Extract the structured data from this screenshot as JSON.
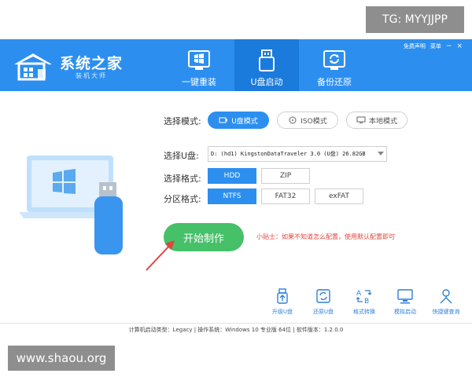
{
  "watermarks": {
    "tg": "TG: MYYJJPP",
    "site": "www.shaou.org"
  },
  "header": {
    "logo_title": "系统之家",
    "logo_subtitle": "装机大师",
    "top_links": [
      "免费声明",
      "菜单"
    ],
    "window_controls": [
      "−",
      "×"
    ],
    "brand_color": "#2c8ff0",
    "tabs": [
      {
        "label": "一键重装",
        "icon": "windows-install-icon",
        "active": false
      },
      {
        "label": "U盘启动",
        "icon": "usb-drive-icon",
        "active": true
      },
      {
        "label": "备份还原",
        "icon": "backup-restore-icon",
        "active": false
      }
    ]
  },
  "mode": {
    "label": "选择模式:",
    "options": [
      {
        "label": "U盘模式",
        "icon": "usb-small-icon",
        "active": true
      },
      {
        "label": "ISO模式",
        "icon": "disc-icon",
        "active": false
      },
      {
        "label": "本地模式",
        "icon": "monitor-icon",
        "active": false
      }
    ]
  },
  "drive": {
    "label": "选择U盘:",
    "value": "D: (hd1) KingstonDataTraveler 3.0 (U盘) 26.82GB"
  },
  "format": {
    "label": "选择格式:",
    "options": [
      {
        "label": "HDD",
        "active": true
      },
      {
        "label": "ZIP",
        "active": false
      }
    ]
  },
  "partition": {
    "label": "分区格式:",
    "options": [
      {
        "label": "NTFS",
        "active": true
      },
      {
        "label": "FAT32",
        "active": false
      },
      {
        "label": "exFAT",
        "active": false
      }
    ]
  },
  "start_button": "开始制作",
  "tip": "小贴士：如果不知道怎么配置，使用默认配置即可",
  "tools": [
    {
      "label": "升级U盘",
      "icon": "upgrade-usb-icon"
    },
    {
      "label": "还原U盘",
      "icon": "restore-usb-icon"
    },
    {
      "label": "格式转换",
      "icon": "format-convert-icon"
    },
    {
      "label": "模拟启动",
      "icon": "simulate-boot-icon"
    },
    {
      "label": "快捷键查询",
      "icon": "shortcut-query-icon"
    }
  ],
  "status": "计算机启动类型：Legacy | 操作系统：Windows 10 专业版 64位 | 软件版本：1.2.0.0",
  "colors": {
    "accent": "#2c8ff0",
    "start_green": "#46c069",
    "tip_red": "#e0443c"
  }
}
